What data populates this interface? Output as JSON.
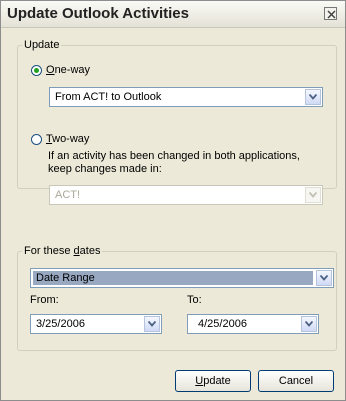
{
  "window": {
    "title": "Update Outlook Activities"
  },
  "update_group": {
    "legend": "Update",
    "one_way": {
      "prefix": "",
      "mnemonic": "O",
      "rest": "ne-way",
      "selected": true
    },
    "one_way_direction": "From ACT! to Outlook",
    "two_way": {
      "mnemonic": "T",
      "rest": "wo-way",
      "selected": false
    },
    "conflict_hint_line1": "If an activity has been changed in both applications,",
    "conflict_hint_line2": "keep changes made in:",
    "conflict_winner": "ACT!"
  },
  "dates_group": {
    "legend_prefix": "For these ",
    "legend_mnemonic": "d",
    "legend_rest": "ates",
    "range_type": "Date Range",
    "from_label": "From:",
    "from_value": "3/25/2006",
    "to_label": "To:",
    "to_value": "4/25/2006"
  },
  "buttons": {
    "update_mnemonic": "U",
    "update_rest": "pdate",
    "cancel": "Cancel"
  },
  "colors": {
    "selection": "#98a8c1",
    "radio_dot": "#21a121",
    "dialog_bg": "#ece9d8"
  }
}
